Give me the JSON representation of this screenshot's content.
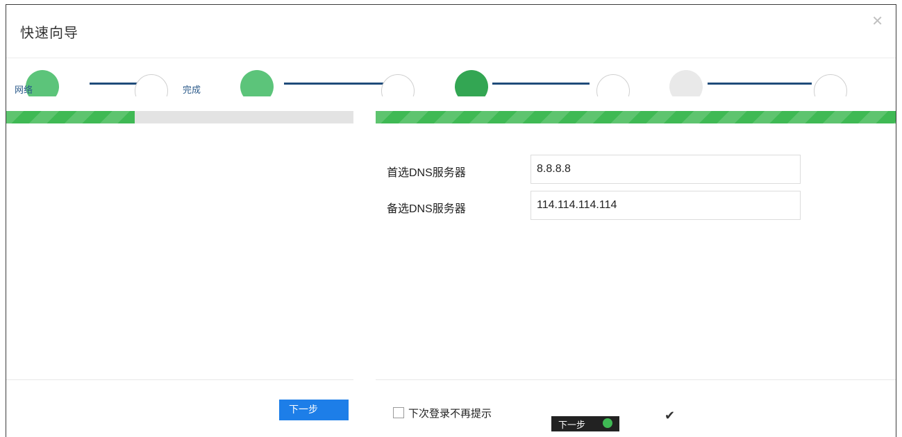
{
  "dialog": {
    "title": "快速向导",
    "close_icon": "close-icon"
  },
  "steps": {
    "items": [
      {
        "label": "网络",
        "state": "done"
      },
      {
        "label": "完成",
        "state": "done"
      },
      {
        "label": "",
        "state": "active"
      },
      {
        "label": "",
        "state": "todo"
      }
    ]
  },
  "progress": {
    "left_fill": 0.37,
    "right_fill": 1.0,
    "color": "#3fb954"
  },
  "form": {
    "primary_dns_label": "首选DNS服务器",
    "primary_dns_value": "8.8.8.8",
    "secondary_dns_label": "备选DNS服务器",
    "secondary_dns_value": "114.114.114.114"
  },
  "footer": {
    "next_left_label": "下一步",
    "dont_show_label": "下次登录不再提示",
    "next_right_label": "下一步",
    "check_icon": "check-icon"
  },
  "colors": {
    "accent_blue": "#1d7ee8",
    "step_green": "#5cc47a",
    "step_active": "#33a653"
  }
}
